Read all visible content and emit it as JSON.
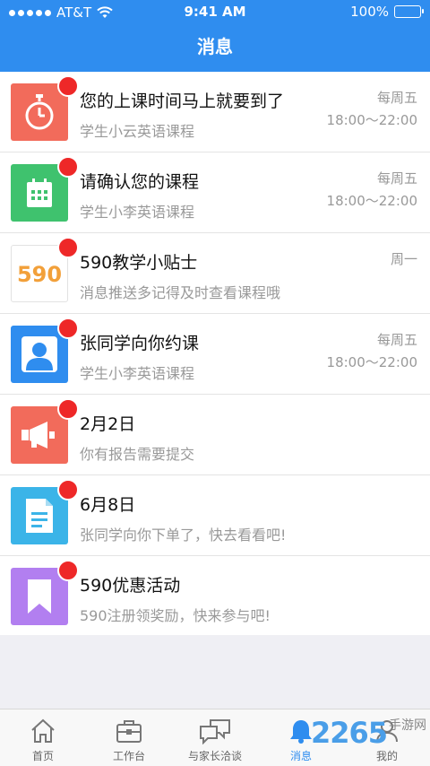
{
  "status": {
    "carrier": "AT&T",
    "time": "9:41 AM",
    "battery": "100%"
  },
  "nav": {
    "title": "消息"
  },
  "messages": [
    {
      "title": "您的上课时间马上就要到了",
      "subtitle": "学生小云英语课程",
      "day": "每周五",
      "time": "18:00～22:00",
      "icon": "stopwatch-icon",
      "color": "#f26b5b"
    },
    {
      "title": "请确认您的课程",
      "subtitle": "学生小李英语课程",
      "day": "每周五",
      "time": "18:00～22:00",
      "icon": "calendar-icon",
      "color": "#3fc26e"
    },
    {
      "title": "590教学小贴士",
      "subtitle": "消息推送多记得及时查看课程哦",
      "day": "周一",
      "time": "",
      "icon": "590-logo",
      "color": "#ffffff"
    },
    {
      "title": "张同学向你约课",
      "subtitle": "学生小李英语课程",
      "day": "每周五",
      "time": "18:00～22:00",
      "icon": "user-icon",
      "color": "#2f8def"
    },
    {
      "title": "2月2日",
      "subtitle": "你有报告需要提交",
      "day": "",
      "time": "",
      "icon": "megaphone-icon",
      "color": "#f26b5b"
    },
    {
      "title": "6月8日",
      "subtitle": "张同学向你下单了，快去看看吧!",
      "day": "",
      "time": "",
      "icon": "document-icon",
      "color": "#3bb4e8"
    },
    {
      "title": "590优惠活动",
      "subtitle": "590注册领奖励，快来参与吧!",
      "day": "",
      "time": "",
      "icon": "bookmark-icon",
      "color": "#b27ff0"
    }
  ],
  "logo_text": "590",
  "tabs": [
    {
      "label": "首页",
      "icon": "home-icon",
      "active": false
    },
    {
      "label": "工作台",
      "icon": "briefcase-icon",
      "active": false
    },
    {
      "label": "与家长洽谈",
      "icon": "chat-icon",
      "active": false
    },
    {
      "label": "消息",
      "icon": "bell-icon",
      "active": true
    },
    {
      "label": "我的",
      "icon": "profile-icon",
      "active": false
    }
  ],
  "watermark": {
    "number": "2265",
    "text": "手游网"
  },
  "colors": {
    "primary": "#2f8def",
    "badge": "#ee2828"
  }
}
